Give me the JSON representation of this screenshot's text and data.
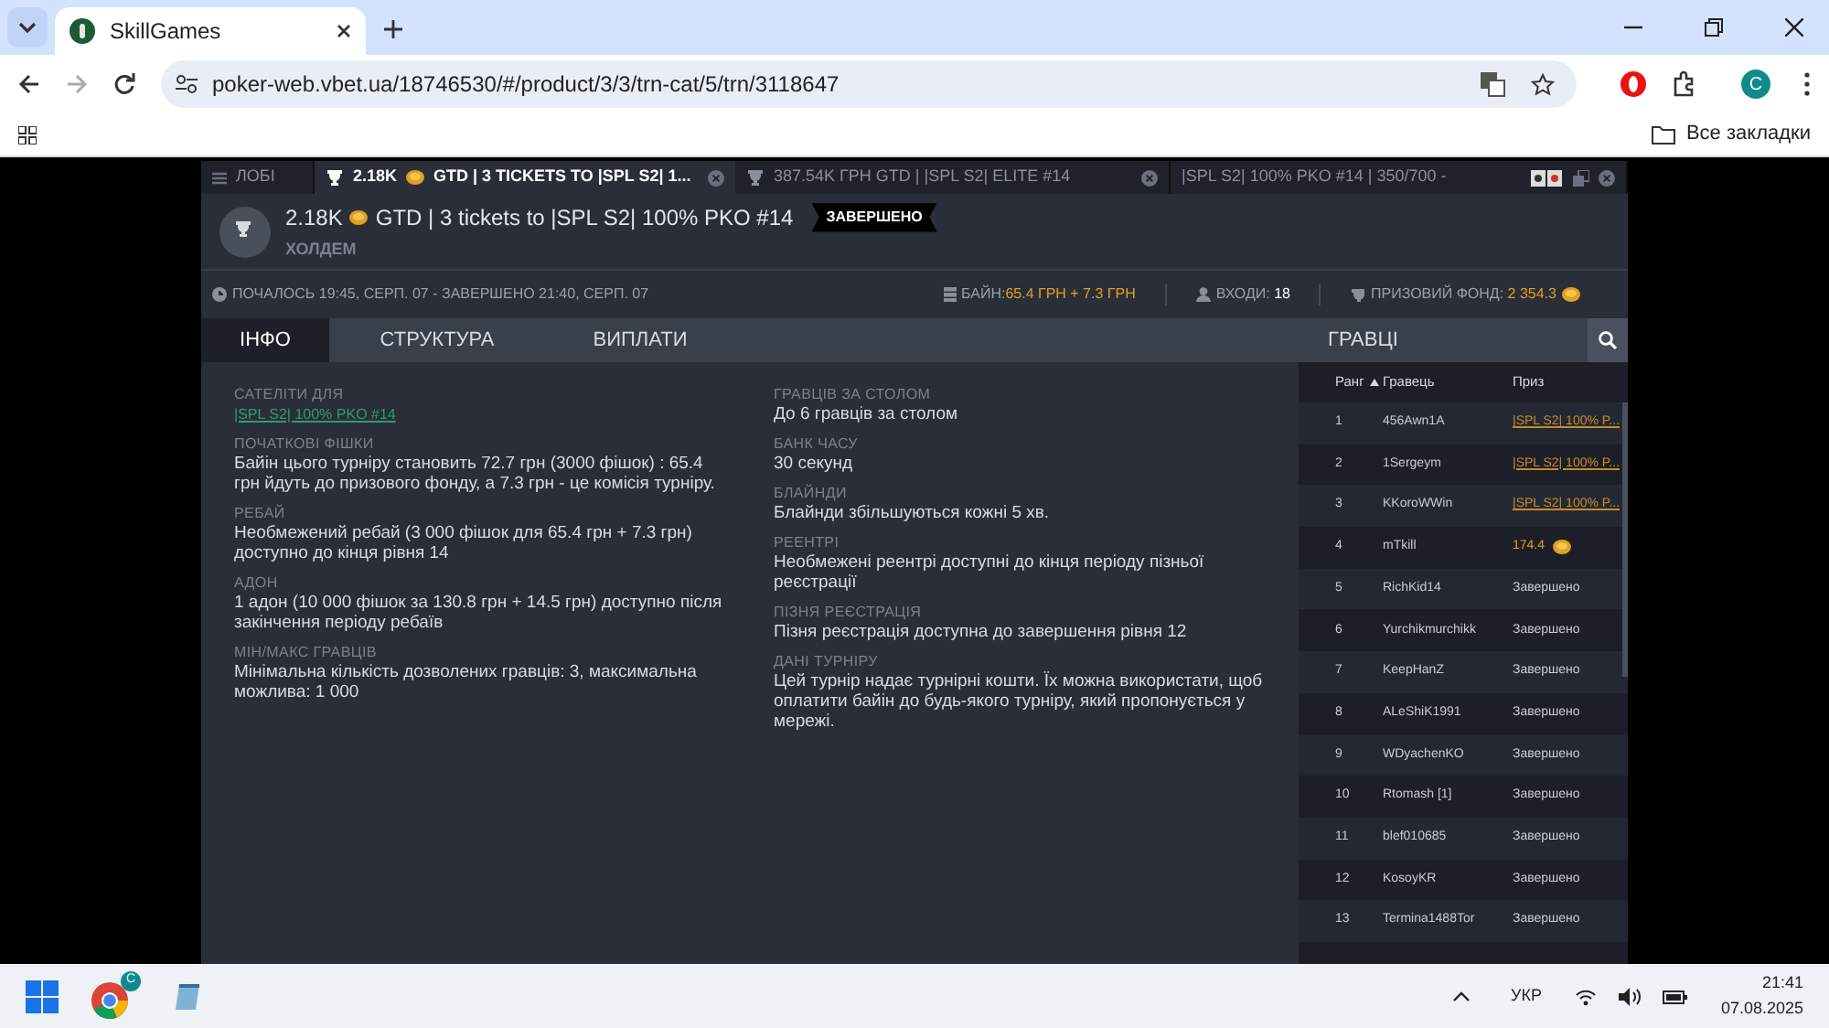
{
  "browser": {
    "tab_title": "SkillGames",
    "url": "poker-web.vbet.ua/18746530/#/product/3/3/trn-cat/5/trn/3118647",
    "bookmarks_label": "Все закладки",
    "profile_letter": "C"
  },
  "game_tabs": [
    {
      "kind": "lobby",
      "label": "ЛОБІ",
      "selected": false
    },
    {
      "kind": "tournament",
      "amount": "2.18K",
      "label": "GTD | 3 TICKETS TO |SPL S2| 1...",
      "selected": true
    },
    {
      "kind": "tournament",
      "label": "387.54K ГРН GTD | |SPL S2| ELITE #14",
      "selected": false
    },
    {
      "kind": "table",
      "label": "|SPL S2| 100% PKO #14 | 350/700 -",
      "selected": false
    }
  ],
  "header": {
    "amount": "2.18K",
    "title": "GTD | 3 tickets to |SPL S2| 100% PKO #14",
    "status": "ЗАВЕРШЕНО",
    "game": "ХОЛДЕМ"
  },
  "info_bar": {
    "time": "ПОЧАЛОСЬ 19:45, СЕРП. 07 - ЗАВЕРШЕНО 21:40, СЕРП. 07",
    "buyin_label": "БАЙН:",
    "buyin": "65.4 ГРН + 7.3 ГРН",
    "entries_label": "ВХОДИ:",
    "entries": "18",
    "prize_label": "ПРИЗОВИЙ ФОНД:",
    "prize": "2 354.3"
  },
  "section_tabs": [
    {
      "label": "ІНФО",
      "selected": true
    },
    {
      "label": "СТРУКТУРА",
      "selected": false
    },
    {
      "label": "ВИПЛАТИ",
      "selected": false
    }
  ],
  "players_title": "ГРАВЦІ",
  "info_left": [
    {
      "label": "САТЕЛІТИ ДЛЯ",
      "kind": "link",
      "value": "|SPL S2| 100% PKO #14"
    },
    {
      "label": "ПОЧАТКОВІ ФІШКИ",
      "kind": "text",
      "value": "Байін цього турніру становить 72.7 грн (3000 фішок) : 65.4 грн йдуть до призового фонду, а 7.3 грн - це комісія турніру."
    },
    {
      "label": "РЕБАЙ",
      "kind": "text",
      "value": "Необмежений ребай (3 000 фішок для 65.4 грн + 7.3 грн) доступно до кінця рівня 14"
    },
    {
      "label": "АДОН",
      "kind": "text",
      "value": "1 адон (10 000 фішок за 130.8 грн + 14.5 грн) доступно після закінчення періоду ребаїв"
    },
    {
      "label": "МІН/МАКС ГРАВЦІВ",
      "kind": "text",
      "value": "Мінімальна кількість дозволених гравців: 3, максимальна можлива: 1 000"
    }
  ],
  "info_right": [
    {
      "label": "ГРАВЦІВ ЗА СТОЛОМ",
      "kind": "text",
      "value": "До 6 гравців за столом"
    },
    {
      "label": "БАНК ЧАСУ",
      "kind": "text",
      "value": "30 секунд"
    },
    {
      "label": "БЛАЙНДИ",
      "kind": "text",
      "value": "Блайнди збільшуються кожні 5 хв."
    },
    {
      "label": "РЕЕНТРІ",
      "kind": "text",
      "value": "Необмежені реентрі доступні до кінця періоду пізньої реєстрації"
    },
    {
      "label": "ПІЗНЯ РЕЄСТРАЦІЯ",
      "kind": "text",
      "value": "Пізня реєстрація доступна до завершення рівня 12"
    },
    {
      "label": "ДАНІ ТУРНІРУ",
      "kind": "text",
      "value": "Цей турнір надає турнірні кошти. Їх можна використати, щоб оплатити байін до будь-якого турніру, який пропонується у мережі."
    }
  ],
  "players": {
    "columns": [
      "Ранг",
      "Гравець",
      "Приз"
    ],
    "rows": [
      {
        "rank": "1",
        "name": "456Awn1A",
        "kind": "link",
        "prize": "|SPL S2| 100% P..."
      },
      {
        "rank": "2",
        "name": "1Sergeym",
        "kind": "link",
        "prize": "|SPL S2| 100% P..."
      },
      {
        "rank": "3",
        "name": "KKoroWWin",
        "kind": "link",
        "prize": "|SPL S2| 100% P..."
      },
      {
        "rank": "4",
        "name": "mTkill",
        "kind": "amount",
        "prize": "174.4"
      },
      {
        "rank": "5",
        "name": "RichKid14",
        "kind": "text",
        "prize": "Завершено"
      },
      {
        "rank": "6",
        "name": "Yurchikmurchikk",
        "kind": "text",
        "prize": "Завершено"
      },
      {
        "rank": "7",
        "name": "KeepHanZ",
        "kind": "text",
        "prize": "Завершено"
      },
      {
        "rank": "8",
        "name": "ALeShiK1991",
        "kind": "text",
        "prize": "Завершено"
      },
      {
        "rank": "9",
        "name": "WDyachenKO",
        "kind": "text",
        "prize": "Завершено"
      },
      {
        "rank": "10",
        "name": "Rtomash [1]",
        "kind": "text",
        "prize": "Завершено"
      },
      {
        "rank": "11",
        "name": "blef010685",
        "kind": "text",
        "prize": "Завершено"
      },
      {
        "rank": "12",
        "name": "KosoyKR",
        "kind": "text",
        "prize": "Завершено"
      },
      {
        "rank": "13",
        "name": "Termina1488Tor",
        "kind": "text",
        "prize": "Завершено"
      }
    ]
  },
  "taskbar": {
    "language": "УКР",
    "time": "21:41",
    "date": "07.08.2025",
    "chrome_badge": "C"
  }
}
